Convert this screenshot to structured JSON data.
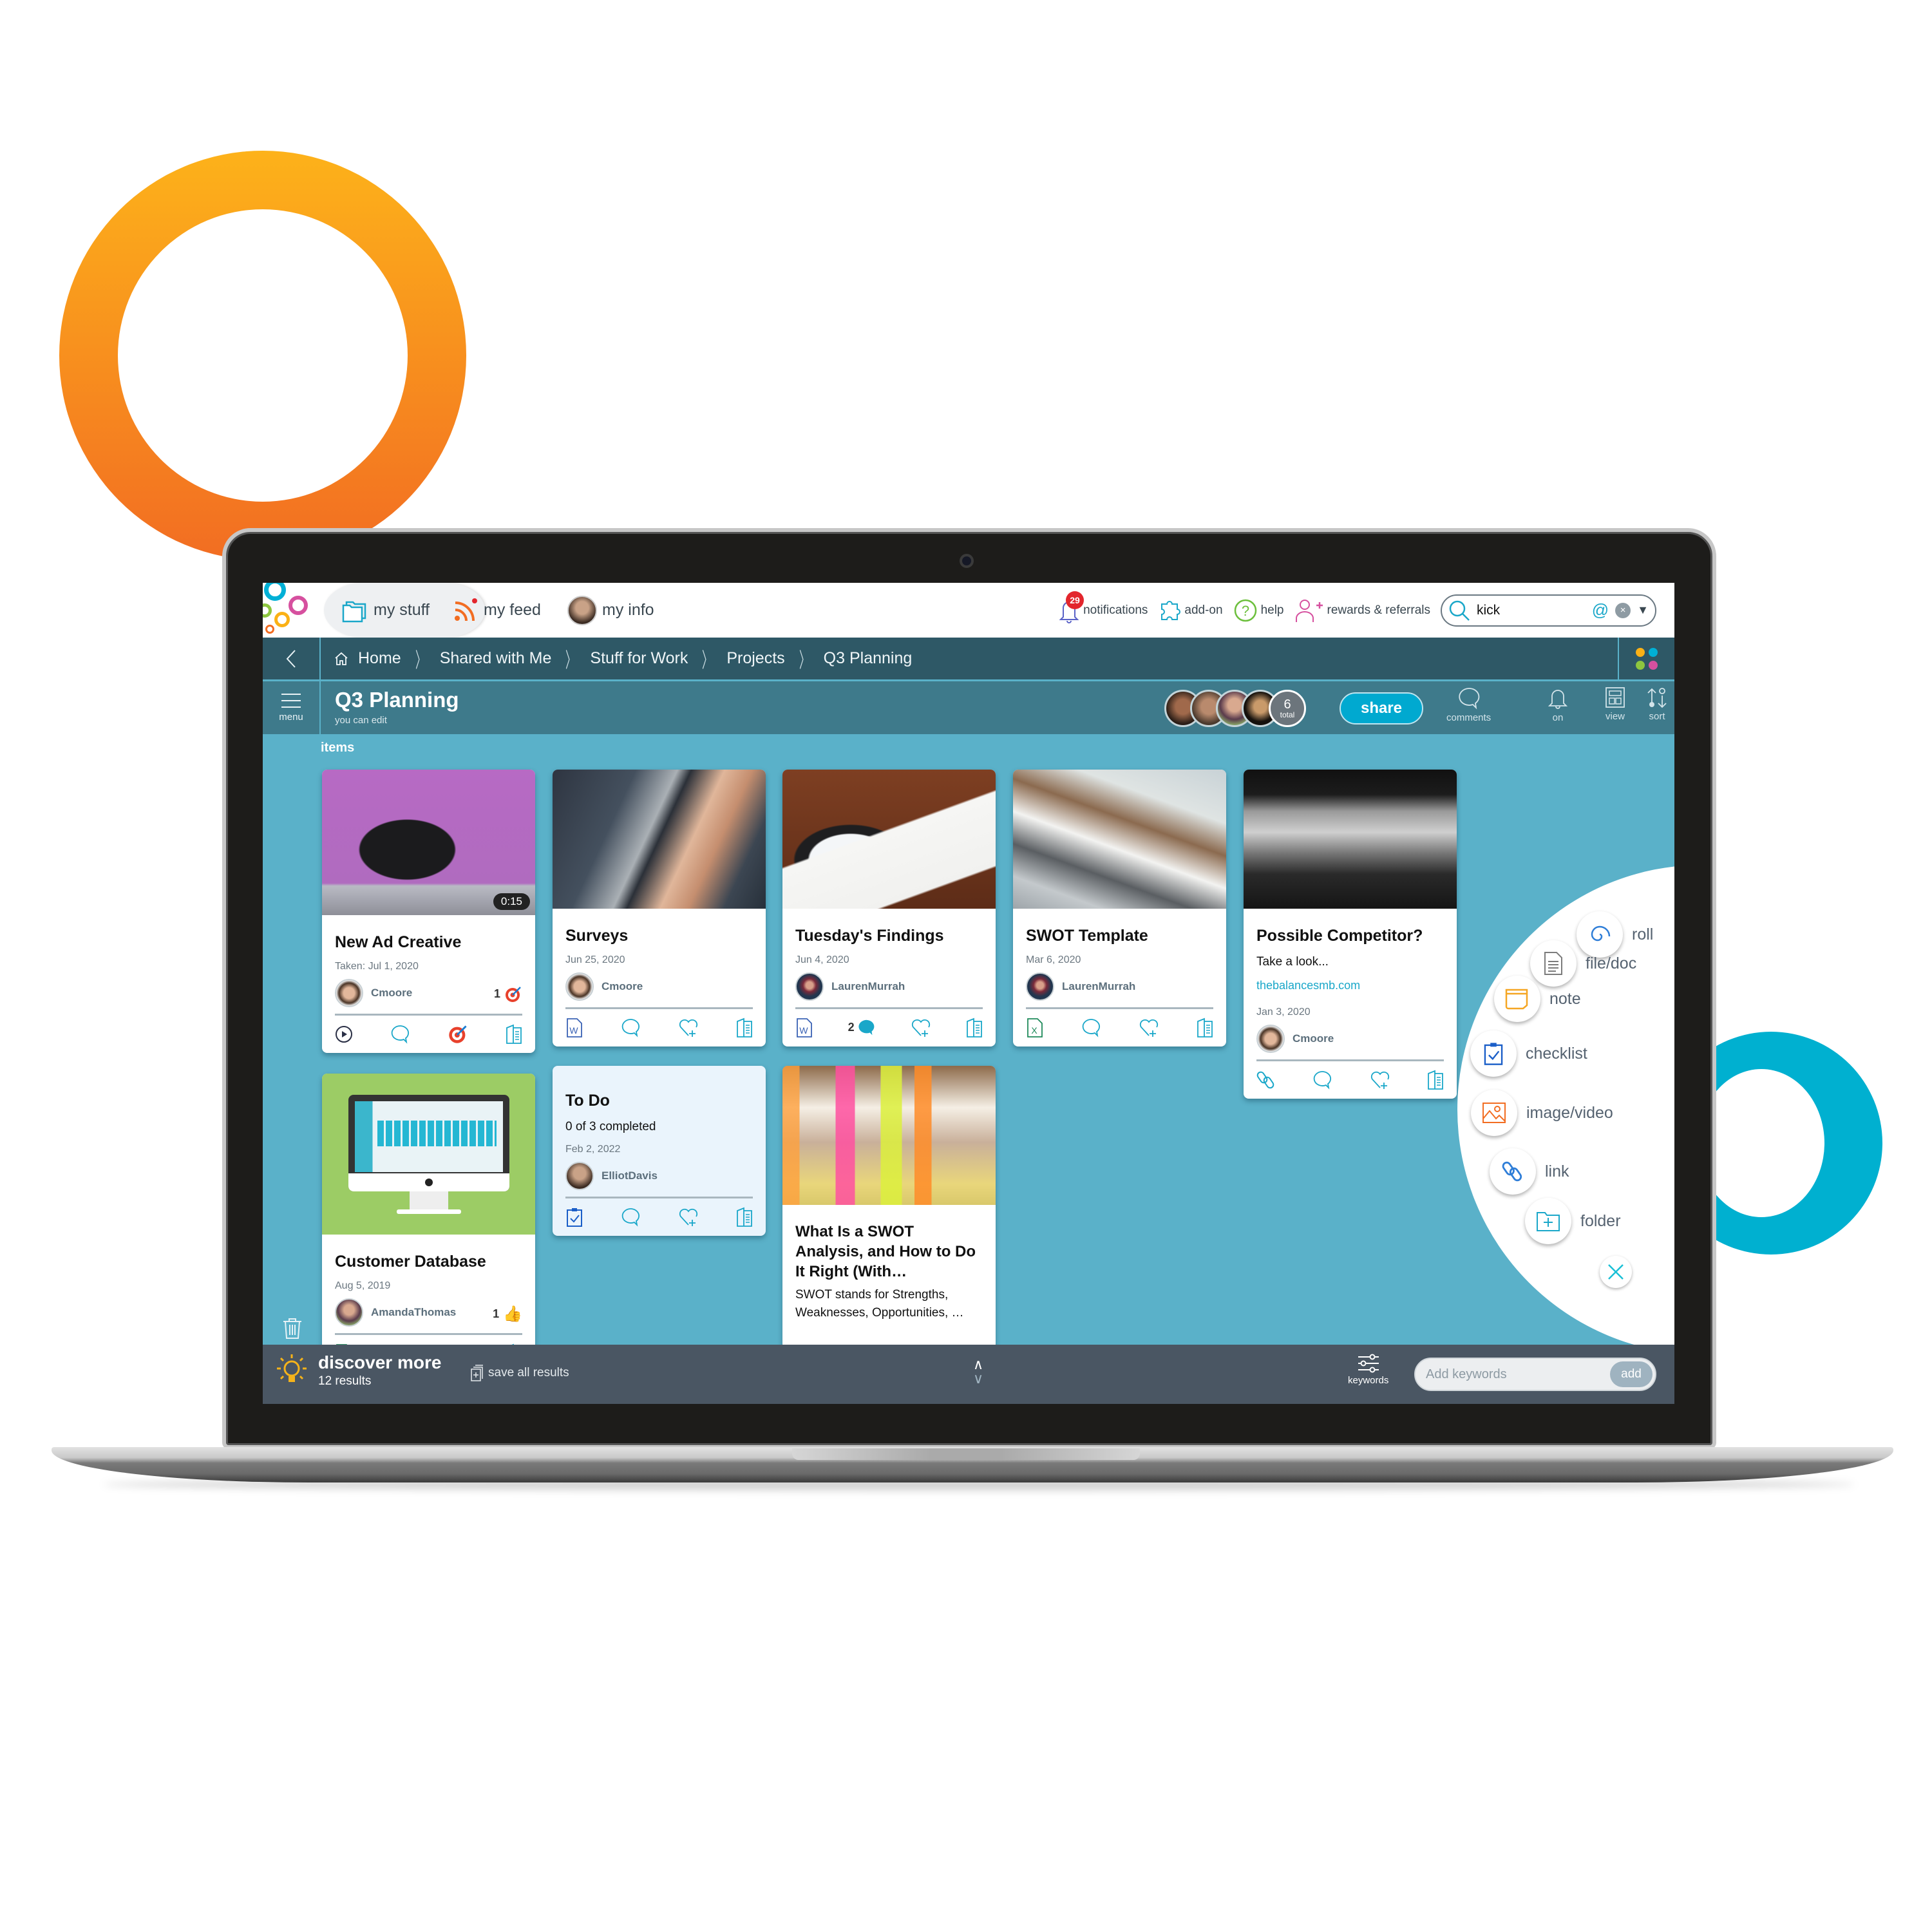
{
  "decor": {
    "orange_ring_colors": [
      "#fdb21a",
      "#f26d22"
    ],
    "blue_ring_color": "#00b0d0"
  },
  "topbar": {
    "tabs": [
      {
        "label": "my stuff",
        "icon": "folders-icon",
        "active": true
      },
      {
        "label": "my feed",
        "icon": "rss-icon",
        "has_dot": true
      },
      {
        "label": "my info",
        "icon": "avatar"
      }
    ],
    "notifications": {
      "label": "notifications",
      "count": "29"
    },
    "addon": {
      "label": "add-on"
    },
    "help": {
      "label": "help"
    },
    "rewards": {
      "label": "rewards & referrals"
    },
    "search": {
      "value": "kick",
      "at_symbol": "@",
      "clear": "×",
      "dropdown": "▼"
    }
  },
  "breadcrumb": {
    "back": "‹",
    "items": [
      "Home",
      "Shared with Me",
      "Stuff for Work",
      "Projects",
      "Q3 Planning"
    ],
    "separator": "〉",
    "apps_colors": [
      "#fbb116",
      "#00b0d6",
      "#8dc63f",
      "#d6509f"
    ]
  },
  "titlebar": {
    "menu_label": "menu",
    "title": "Q3 Planning",
    "subtitle": "you can edit",
    "collaborators_total": "6",
    "collaborators_total_label": "total",
    "share_label": "share",
    "tools": [
      {
        "label": "comments",
        "icon": "comment-icon"
      },
      {
        "label": "on",
        "icon": "bell-icon"
      },
      {
        "label": "view",
        "icon": "layout-icon"
      },
      {
        "label": "sort",
        "icon": "sort-icon"
      }
    ]
  },
  "content": {
    "section_label": "items",
    "cards": [
      {
        "title": "New Ad Creative",
        "date": "Taken: Jul 1, 2020",
        "author": "Cmoore",
        "duration": "0:15",
        "reaction_count": "1",
        "reaction": "target",
        "type_icon": "play-icon",
        "image": "camera"
      },
      {
        "title": "Surveys",
        "date": "Jun 25, 2020",
        "author": "Cmoore",
        "type_icon": "word-doc-icon",
        "image": "laptop-hands"
      },
      {
        "title": "Tuesday's Findings",
        "date": "Jun 4, 2020",
        "author": "LaurenMurrah",
        "type_icon": "word-doc-icon",
        "comment_count": "2",
        "image": "tablet-charts"
      },
      {
        "title": "SWOT Template",
        "date": "Mar 6, 2020",
        "author": "LaurenMurrah",
        "type_icon": "excel-doc-icon",
        "image": "desk-laptops"
      },
      {
        "title": "Possible Competitor?",
        "description": "Take a look...",
        "link": "thebalancesmb.com",
        "date": "Jan 3, 2020",
        "author": "Cmoore",
        "type_icon": "link-icon",
        "image": "office-silhouettes"
      },
      {
        "title": "Customer Database",
        "date": "Aug 5, 2019",
        "author": "AmandaThomas",
        "reaction_count": "1",
        "reaction": "thumbs-up",
        "type_icon": "doc-icon",
        "image": "monitor-dashboard"
      },
      {
        "title": "To Do",
        "description": "0 of 3 completed",
        "date": "Feb 2, 2022",
        "author": "ElliotDavis",
        "type_icon": "checklist-icon"
      },
      {
        "title": "What Is a SWOT Analysis, and How to Do It Right (With…",
        "description": "SWOT stands for Strengths, Weaknesses, Opportunities, …",
        "image": "sticky-notes-team"
      }
    ]
  },
  "add_menu": {
    "items": [
      {
        "label": "roll",
        "icon": "spiral-icon"
      },
      {
        "label": "file/doc",
        "icon": "document-icon"
      },
      {
        "label": "note",
        "icon": "note-icon"
      },
      {
        "label": "checklist",
        "icon": "checklist-icon"
      },
      {
        "label": "image/video",
        "icon": "image-icon"
      },
      {
        "label": "link",
        "icon": "link-icon"
      },
      {
        "label": "folder",
        "icon": "folder-plus-icon"
      }
    ],
    "close": "×"
  },
  "bottombar": {
    "discover_title": "discover more",
    "discover_count": "12 results",
    "save_all": "save all results",
    "up": "∧",
    "down": "∨",
    "keywords_label": "keywords",
    "keywords_placeholder": "Add keywords",
    "add_label": "add"
  }
}
